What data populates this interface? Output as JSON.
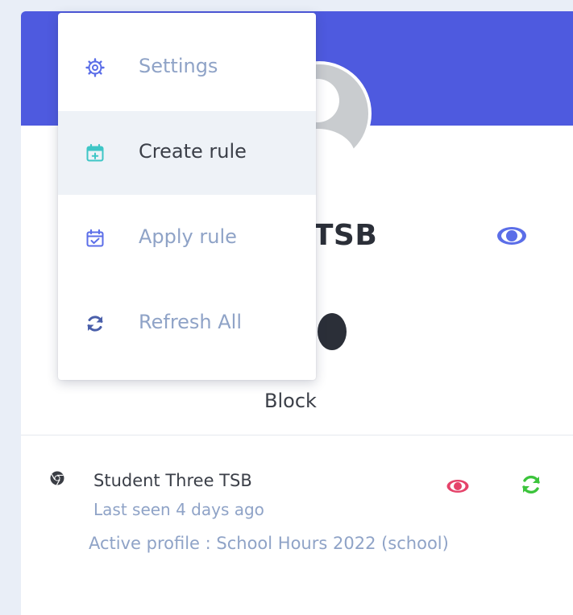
{
  "menu": {
    "items": [
      {
        "label": "Settings",
        "icon": "gear-icon"
      },
      {
        "label": "Create rule",
        "icon": "calendar-plus-icon"
      },
      {
        "label": "Apply rule",
        "icon": "calendar-check-icon"
      },
      {
        "label": "Refresh All",
        "icon": "refresh-icon"
      }
    ],
    "active_index": 1
  },
  "profile": {
    "name_fragment": "ee TSB",
    "status_label": "Block"
  },
  "device": {
    "name": "Student Three TSB",
    "last_seen": "Last seen 4 days ago",
    "active_profile": "Active profile : School Hours 2022 (school)"
  },
  "colors": {
    "header": "#4e5adf",
    "muted_text": "#8fa3c7",
    "dark_text": "#2b2f38",
    "accent_teal": "#3ec6c6",
    "eye_red": "#e5436a",
    "refresh_green": "#3cc43c"
  }
}
